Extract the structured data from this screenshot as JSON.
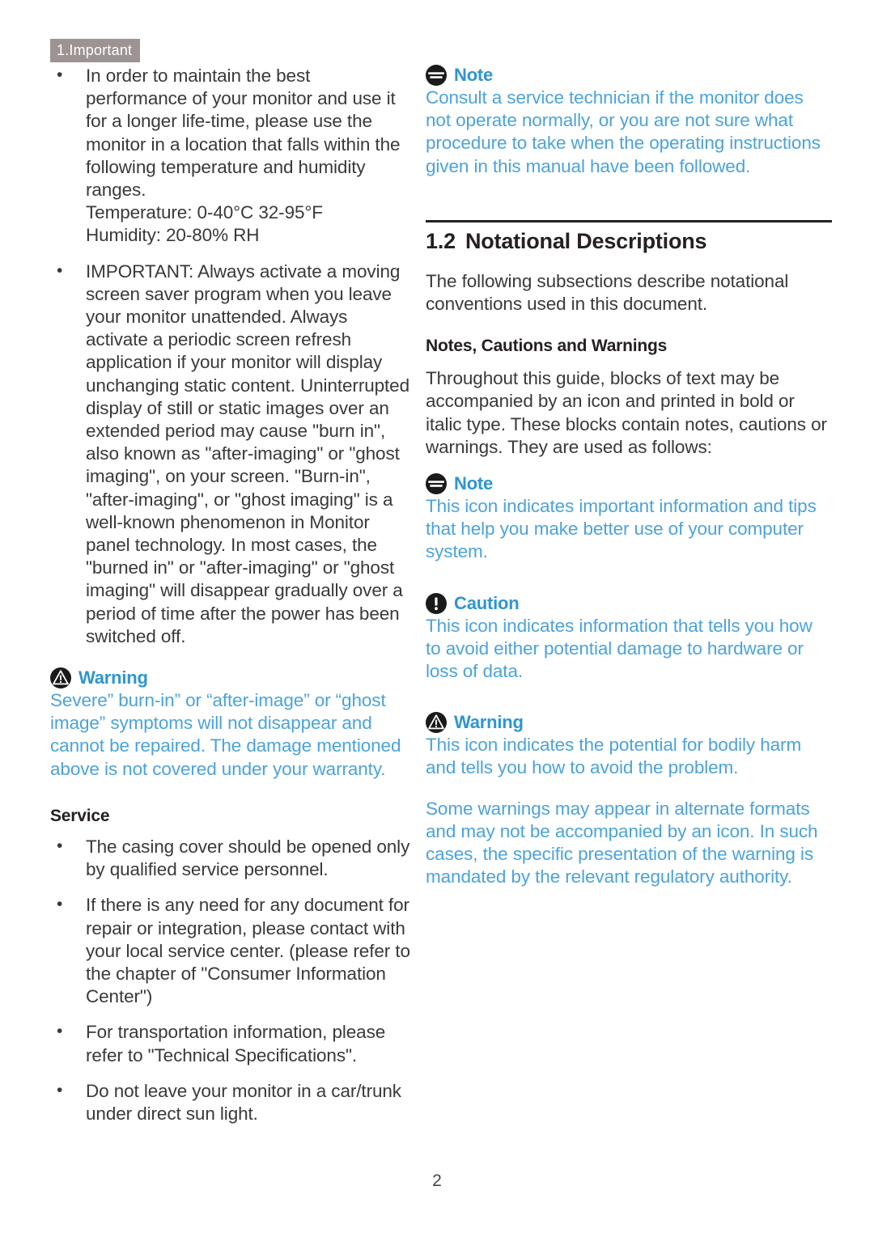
{
  "chapter": {
    "badge_label": "1.Important",
    "badge_bg": "#9d9393",
    "badge_fg": "#ffffff"
  },
  "colors": {
    "body_text": "#3b3838",
    "callout_title": "#2e95d3",
    "callout_body": "#4ba3db",
    "heading": "#262020"
  },
  "left_column": {
    "bullets": [
      {
        "text": "In order to maintain the best performance of your monitor and use it for a longer life-time, please use the monitor in a location that falls within the following temperature and humidity ranges.",
        "line2": "Temperature: 0-40°C 32-95°F",
        "line3": "Humidity: 20-80% RH"
      },
      {
        "text": "IMPORTANT: Always activate a moving screen saver program when you leave your monitor unattended. Always activate a periodic screen refresh application if your monitor will display unchanging static content. Uninterrupted display of still or static images over an extended period may cause \"burn in\", also known as \"after-imaging\" or \"ghost imaging\", on your screen. \"Burn-in\", \"after-imaging\", or \"ghost imaging\" is a well-known phenomenon in Monitor panel technology. In most cases, the \"burned in\" or \"after-imaging\" or \"ghost imaging\" will disappear gradually over a period of time after the power has been switched off."
      }
    ],
    "warning_callout": {
      "icon": "warning-triangle-icon",
      "title": "Warning",
      "body": "Severe” burn-in” or “after-image” or “ghost image” symptoms will not disappear and cannot be repaired. The damage mentioned above is not covered under your warranty."
    },
    "service_heading": "Service",
    "service_bullets": [
      "The casing cover should be opened only by qualified service personnel.",
      "If there is any need for any document for repair or integration, please contact with your local service center. (please refer to the chapter of \"Consumer Information Center\")",
      "For transportation information, please refer to \"Technical Specifications\".",
      "Do not leave your monitor in a car/trunk under direct sun light."
    ]
  },
  "right_column": {
    "top_note": {
      "icon": "note-icon",
      "title": "Note",
      "body": "Consult a service technician if the monitor does not operate normally, or you are not sure what procedure to take when the operating instructions given in this manual have been followed."
    },
    "section": {
      "number": "1.2",
      "title": "Notational Descriptions",
      "intro": "The following subsections describe notational conventions used in this document."
    },
    "sub_heading": "Notes, Cautions and Warnings",
    "sub_intro": "Throughout this guide, blocks of text may be accompanied by an icon and printed in bold or italic type. These blocks contain notes, cautions or warnings. They are used as follows:",
    "note_callout": {
      "icon": "note-icon",
      "title": "Note",
      "body": "This icon indicates important information and tips that help you make better use of your computer system."
    },
    "caution_callout": {
      "icon": "caution-icon",
      "title": "Caution",
      "body": "This icon indicates information that tells you how to avoid either potential damage to hardware or loss of data."
    },
    "warning_callout": {
      "icon": "warning-triangle-icon",
      "title": "Warning",
      "body": "This icon indicates the potential for bodily harm and tells you how to avoid the problem.",
      "body2": "Some warnings may appear in alternate formats and may not be accompanied by an icon. In such cases, the specific presentation of the warning is mandated by the relevant regulatory authority."
    }
  },
  "footer": {
    "page_number": "2"
  }
}
